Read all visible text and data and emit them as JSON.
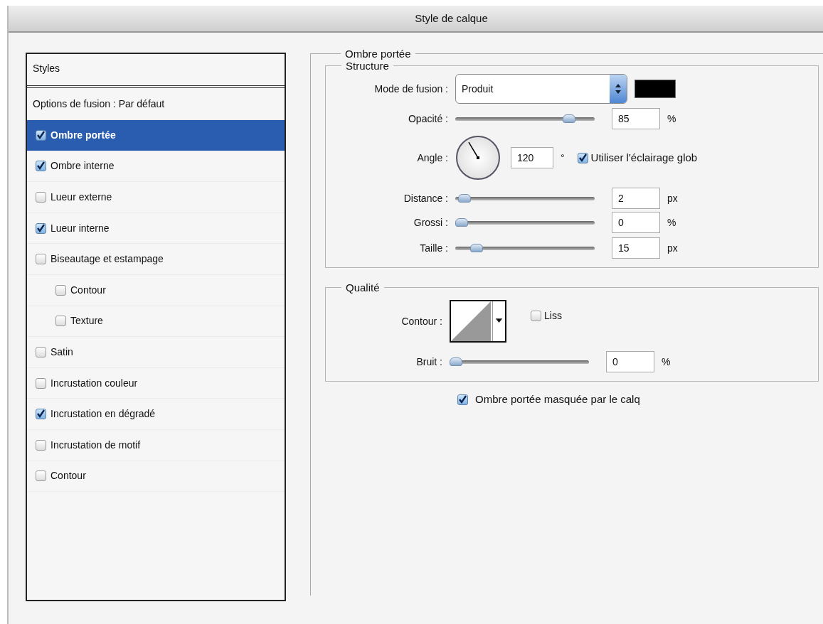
{
  "window": {
    "title": "Style de calque"
  },
  "sidebar": {
    "header": "Styles",
    "blend_options": "Options de fusion : Par défaut",
    "items": [
      {
        "label": "Ombre portée",
        "checked": true,
        "selected": true
      },
      {
        "label": "Ombre interne",
        "checked": true,
        "selected": false
      },
      {
        "label": "Lueur externe",
        "checked": false,
        "selected": false
      },
      {
        "label": "Lueur interne",
        "checked": true,
        "selected": false
      },
      {
        "label": "Biseautage et estampage",
        "checked": false,
        "selected": false,
        "children": [
          {
            "label": "Contour",
            "checked": false,
            "selected": false
          },
          {
            "label": "Texture",
            "checked": false,
            "selected": false
          }
        ]
      },
      {
        "label": "Satin",
        "checked": false,
        "selected": false
      },
      {
        "label": "Incrustation couleur",
        "checked": false,
        "selected": false
      },
      {
        "label": "Incrustation en dégradé",
        "checked": true,
        "selected": false
      },
      {
        "label": "Incrustation de motif",
        "checked": false,
        "selected": false
      },
      {
        "label": "Contour",
        "checked": false,
        "selected": false
      }
    ]
  },
  "panel": {
    "title": "Ombre portée",
    "structure": {
      "title": "Structure",
      "rows": [
        {
          "kind": "select",
          "label": "Mode de fusion :",
          "value": "Produit",
          "swatch": {
            "color": "#000000"
          }
        },
        {
          "kind": "slider",
          "label": "Opacité :",
          "level": 0.85,
          "value": "85",
          "unit": "%"
        },
        {
          "kind": "angle",
          "label": "Angle :",
          "value": "120",
          "unit": "°",
          "global_light": {
            "label": "Utiliser l'éclairage glob",
            "checked": true
          }
        },
        {
          "kind": "slider",
          "label": "Distance :",
          "level": 0.02,
          "value": "2",
          "unit": "px"
        },
        {
          "kind": "slider",
          "label": "Grossi :",
          "level": 0,
          "value": "0",
          "unit": "%"
        },
        {
          "kind": "slider",
          "label": "Taille :",
          "level": 0.12,
          "value": "15",
          "unit": "px"
        }
      ]
    },
    "quality": {
      "title": "Qualité",
      "contour": {
        "label": "Contour :",
        "antialias": {
          "label": "Liss",
          "checked": false
        }
      },
      "noise": {
        "label": "Bruit :",
        "level": 0,
        "value": "0",
        "unit": "%"
      }
    },
    "knockout": {
      "label": "Ombre portée masquée par le calq",
      "checked": true
    }
  }
}
